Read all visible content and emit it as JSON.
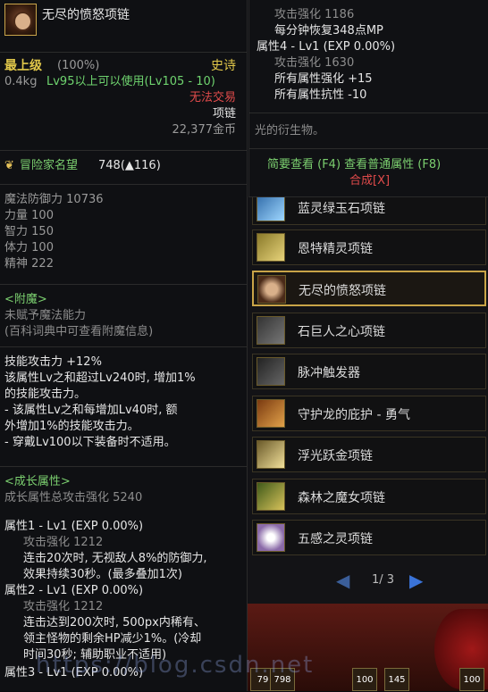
{
  "tooltip": {
    "item_name": "无尽的愤怒项链",
    "grade": "最上级",
    "grade_pct": "(100%)",
    "rarity": "史诗",
    "weight": "0.4kg",
    "level_req": "Lv95以上可以使用(Lv105 - 10)",
    "trade": "无法交易",
    "slot_type": "项链",
    "price": "22,377金币",
    "reputation_label": "冒险家名望",
    "reputation_value": "748(▲116)",
    "stats": [
      {
        "label": "魔法防御力",
        "value": "10736"
      },
      {
        "label": "力量",
        "value": "100"
      },
      {
        "label": "智力",
        "value": "150"
      },
      {
        "label": "体力",
        "value": "100"
      },
      {
        "label": "精神",
        "value": "222"
      }
    ],
    "enchant_title": "<附魔>",
    "enchant_line1": "未赋予魔法能力",
    "enchant_line2": "(百科词典中可查看附魔信息)",
    "skill_lines": [
      "技能攻击力 +12%",
      "该属性Lv之和超过Lv240时, 增加1%",
      "的技能攻击力。",
      "- 该属性Lv之和每增加Lv40时, 额",
      "外增加1%的技能攻击力。",
      "- 穿戴Lv100以下装备时不适用。"
    ],
    "growth_title": "<成长属性>",
    "growth_total": "成长属性总攻击强化 5240",
    "attr1_head": "属性1 - Lv1 (EXP 0.00%)",
    "attr1_atk": "攻击强化 1212",
    "attr1_desc1": "连击20次时, 无视敌人8%的防御力,",
    "attr1_desc2": "效果持续30秒。(最多叠加1次)",
    "attr2_head": "属性2 - Lv1 (EXP 0.00%)",
    "attr2_atk": "攻击强化 1212",
    "attr2_desc1": "连击达到200次时, 500px内稀有、",
    "attr2_desc2": "领主怪物的剩余HP减少1%。(冷却",
    "attr2_desc3": "时间30秒; 辅助职业不适用)",
    "attr3_head": "属性3 - Lv1 (EXP 0.00%)"
  },
  "upper": {
    "l1": "攻击强化 1186",
    "l2": "每分钟恢复348点MP",
    "l3": "属性4 - Lv1 (EXP 0.00%)",
    "l4": "攻击强化 1630",
    "l5": "所有属性强化 +15",
    "l6": "所有属性抗性 -10",
    "flavor": "光的衍生物。",
    "actions": "简要查看 (F4) 查看普通属性 (F8)",
    "synth": "合成[X]"
  },
  "list": [
    {
      "label": "蓝灵绿玉石项链",
      "icon": "blue-gem-necklace-icon"
    },
    {
      "label": "恩特精灵项链",
      "icon": "ent-spirit-necklace-icon"
    },
    {
      "label": "无尽的愤怒项链",
      "icon": "endless-rage-necklace-icon",
      "selected": true
    },
    {
      "label": "石巨人之心项链",
      "icon": "golem-heart-necklace-icon"
    },
    {
      "label": "脉冲触发器",
      "icon": "pulse-trigger-icon"
    },
    {
      "label": "守护龙的庇护 - 勇气",
      "icon": "guardian-dragon-icon"
    },
    {
      "label": "浮光跃金项链",
      "icon": "floating-gold-necklace-icon"
    },
    {
      "label": "森林之魔女项链",
      "icon": "forest-witch-necklace-icon"
    },
    {
      "label": "五感之灵项链",
      "icon": "five-senses-necklace-icon"
    }
  ],
  "pager": {
    "text": "1/ 3"
  },
  "hotbar": {
    "slot1": "79",
    "slot2": "798",
    "slot3": "100",
    "slot4": "145",
    "slot5": "100"
  },
  "watermark": "https://blog.csdn.net"
}
